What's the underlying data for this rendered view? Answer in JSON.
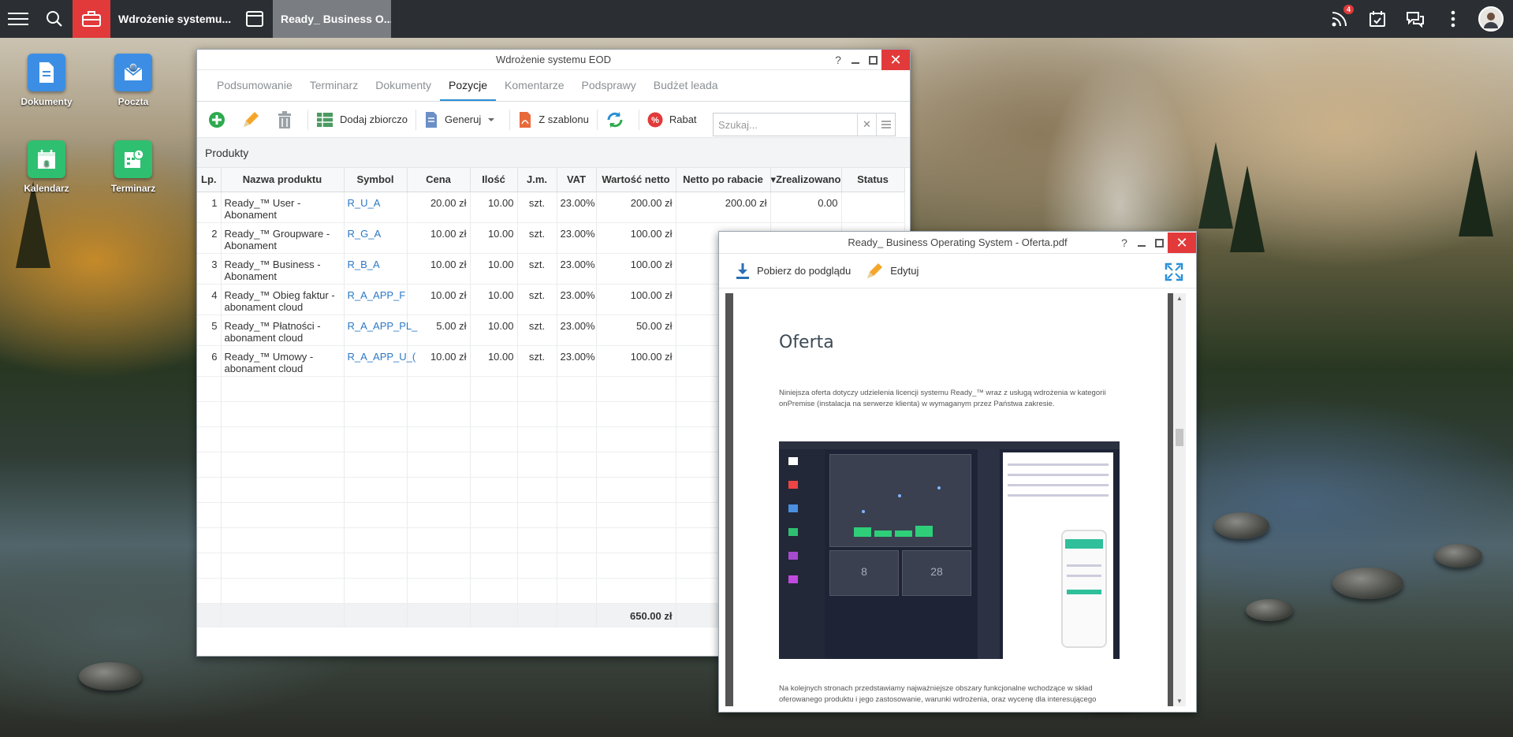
{
  "taskbar": {
    "tasks": [
      {
        "label": "Wdrożenie systemu..."
      },
      {
        "label": "Ready_ Business O..."
      }
    ],
    "notification_count": "4"
  },
  "desktop": {
    "icons": [
      {
        "label": "Dokumenty"
      },
      {
        "label": "Poczta"
      },
      {
        "label": "Kalendarz",
        "day": "8"
      },
      {
        "label": "Terminarz"
      }
    ]
  },
  "eod_window": {
    "title": "Wdrożenie systemu EOD",
    "tabs": [
      "Podsumowanie",
      "Terminarz",
      "Dokumenty",
      "Pozycje",
      "Komentarze",
      "Podsprawy",
      "Budżet leada"
    ],
    "active_tab": "Pozycje",
    "toolbar": {
      "bulk_add": "Dodaj zbiorczo",
      "generate": "Generuj",
      "from_template": "Z szablonu",
      "discount": "Rabat"
    },
    "search_placeholder": "Szukaj...",
    "section_title": "Produkty",
    "columns": [
      "Lp.",
      "Nazwa produktu",
      "Symbol",
      "Cena",
      "Ilość",
      "J.m.",
      "VAT",
      "Wartość netto",
      "Netto po rabacie",
      "Zrealizowano",
      "Status"
    ],
    "rows": [
      {
        "lp": "1",
        "name": "Ready_™ User - Abonament",
        "symbol": "R_U_A",
        "price": "20.00 zł",
        "qty": "10.00",
        "unit": "szt.",
        "vat": "23.00%",
        "net": "200.00 zł",
        "net_disc": "200.00 zł",
        "done": "0.00",
        "status": ""
      },
      {
        "lp": "2",
        "name": "Ready_™ Groupware - Abonament",
        "symbol": "R_G_A",
        "price": "10.00 zł",
        "qty": "10.00",
        "unit": "szt.",
        "vat": "23.00%",
        "net": "100.00 zł",
        "net_disc": "",
        "done": "",
        "status": ""
      },
      {
        "lp": "3",
        "name": "Ready_™ Business - Abonament",
        "symbol": "R_B_A",
        "price": "10.00 zł",
        "qty": "10.00",
        "unit": "szt.",
        "vat": "23.00%",
        "net": "100.00 zł",
        "net_disc": "",
        "done": "",
        "status": ""
      },
      {
        "lp": "4",
        "name": "Ready_™ Obieg faktur - abonament cloud",
        "symbol": "R_A_APP_F",
        "price": "10.00 zł",
        "qty": "10.00",
        "unit": "szt.",
        "vat": "23.00%",
        "net": "100.00 zł",
        "net_disc": "",
        "done": "",
        "status": ""
      },
      {
        "lp": "5",
        "name": "Ready_™ Płatności - abonament cloud",
        "symbol": "R_A_APP_PL_",
        "price": "5.00 zł",
        "qty": "10.00",
        "unit": "szt.",
        "vat": "23.00%",
        "net": "50.00 zł",
        "net_disc": "",
        "done": "",
        "status": ""
      },
      {
        "lp": "6",
        "name": "Ready_™ Umowy - abonament cloud",
        "symbol": "R_A_APP_U_(",
        "price": "10.00 zł",
        "qty": "10.00",
        "unit": "szt.",
        "vat": "23.00%",
        "net": "100.00 zł",
        "net_disc": "",
        "done": "",
        "status": ""
      }
    ],
    "total_net": "650.00 zł"
  },
  "pdf_window": {
    "title": "Ready_ Business Operating System - Oferta.pdf",
    "download_label": "Pobierz do podglądu",
    "edit_label": "Edytuj",
    "page": {
      "heading": "Oferta",
      "intro": "Niniejsza oferta dotyczy udzielenia licencji systemu Ready_™ wraz z usługą wdrożenia w kategorii onPremise (instalacja na serwerze klienta) w wymaganym przez Państwa zakresie.",
      "outro": "Na kolejnych stronach przedstawiamy najważniejsze obszary funkcjonalne wchodzące w skład oferowanego produktu i jego zastosowanie, warunki wdrożenia, oraz wycenę dla interesującego",
      "mock_stat_1": "8",
      "mock_stat_2": "28"
    }
  },
  "colors": {
    "accent_red": "#e23a3a",
    "accent_blue": "#2a8fd6",
    "taskbar": "#2b2f33"
  }
}
